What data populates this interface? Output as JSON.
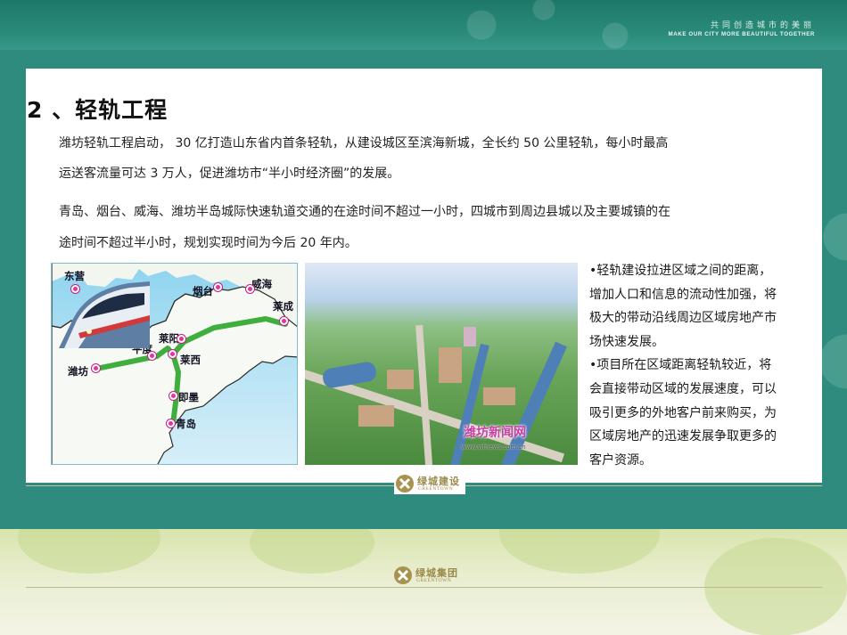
{
  "header": {
    "slogan_cn": "共同创造城市的美丽",
    "slogan_en": "MAKE OUR CITY MORE BEAUTIFUL TOGETHER"
  },
  "slide": {
    "title": "2 、轻轨工程",
    "paragraphs": [
      "潍坊轻轨工程启动， 30 亿打造山东省内首条轻轨，从建设城区至滨海新城，全长约 50 公里轻轨，每小时最高",
      "运送客流量可达 3 万人，促进潍坊市“半小时经济圈”的发展。",
      "青岛、烟台、威海、潍坊半岛城际快速轨道交通的在途时间不超过一小时，四城市到周边县城以及主要城镇的在",
      "途时间不超过半小时，规划实现时间为今后 20 年内。"
    ],
    "bullet_lines": [
      "•轻轨建设拉进区域之间的距离，",
      "增加人口和信息的流动性加强，将",
      "极大的带动沿线周边区域房地产市",
      "场快速发展。",
      "•项目所在区域距离轻轨较近，将",
      "会直接带动区域的发展速度，可以",
      "吸引更多的外地客户前来购买，为",
      "区域房地产的迅速发展争取更多的",
      "客户资源。"
    ]
  },
  "map": {
    "cities": {
      "dongying": "东营",
      "yantai": "烟台",
      "weihai": "威海",
      "laicheng": "莱成",
      "laiyang": "莱阳",
      "pingdu": "平度",
      "laixi": "莱西",
      "weifang": "潍坊",
      "jimo": "即墨",
      "qingdao": "青岛"
    },
    "colors": {
      "route": "#3fae3f",
      "station": "#e5329c"
    }
  },
  "aerial": {
    "watermark": "潍坊新闻网",
    "watermark_url": "www.wfnews.com.cn"
  },
  "logos": {
    "card_logo_cn": "绿城建设",
    "card_logo_en": "GREENTOWN",
    "bottom_logo_cn": "绿城集团",
    "bottom_logo_en": "GREENTOWN"
  }
}
